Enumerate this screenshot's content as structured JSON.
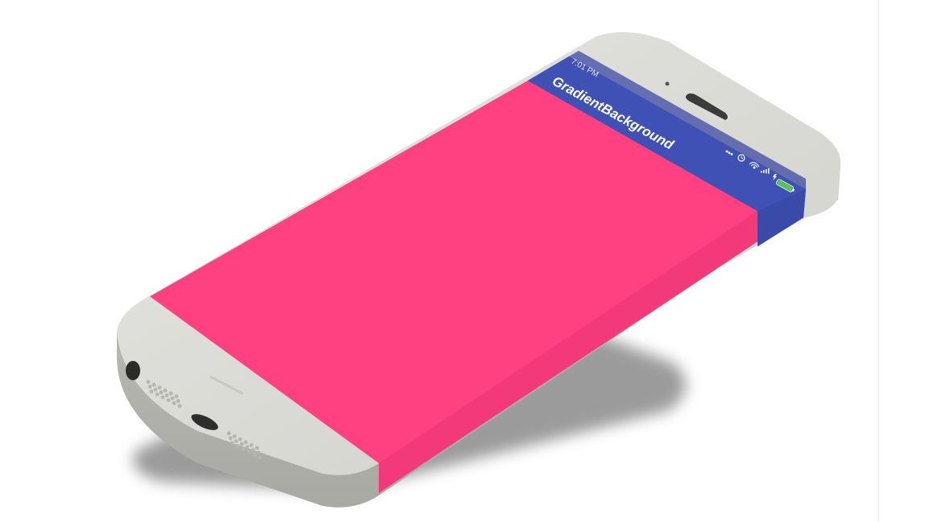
{
  "app": {
    "title": "GradientBackground"
  },
  "status_bar": {
    "time": "7:01 PM",
    "icons": [
      "more-dots-icon",
      "alarm-icon",
      "wifi-icon",
      "signal-icon",
      "charging-icon",
      "battery-icon"
    ]
  },
  "colors": {
    "app_bar": "#3f51b5",
    "status_bar": "#303f9f",
    "content_background": "#ff4081",
    "gradient_center": "#3f51b5",
    "phone_body": "#dcdcd8",
    "battery_fill": "#4cd137"
  }
}
